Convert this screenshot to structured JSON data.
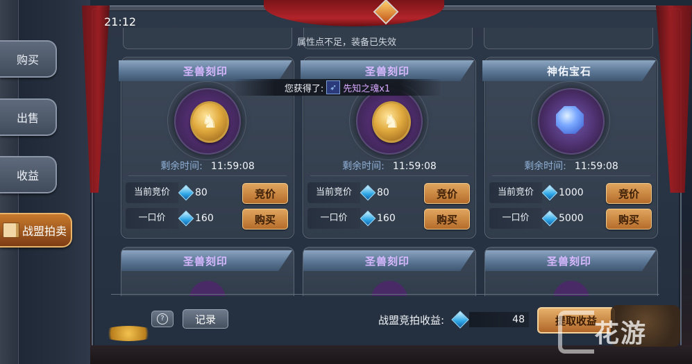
{
  "clock": "21:12",
  "notice": "属性点不足，装备已失效",
  "sidebar": {
    "tabs": [
      {
        "label": "购买",
        "active": false
      },
      {
        "label": "出售",
        "active": false
      },
      {
        "label": "收益",
        "active": false
      },
      {
        "label": "战盟拍卖",
        "active": true
      }
    ]
  },
  "banner": {
    "prefix": "您获得了:",
    "item": "先知之魂x1"
  },
  "labels": {
    "remain": "剩余时间:",
    "current_bid": "当前竞价",
    "buyout": "一口价",
    "bid_btn": "竞价",
    "buy_btn": "购买"
  },
  "cards": [
    {
      "title": "圣兽刻印",
      "item_icon": "golden-horse-medal-icon",
      "remain_time": "11:59:08",
      "current_bid": "80",
      "buyout": "160"
    },
    {
      "title": "圣兽刻印",
      "item_icon": "golden-horse-medal-icon",
      "remain_time": "11:59:08",
      "current_bid": "80",
      "buyout": "160"
    },
    {
      "title": "神佑宝石",
      "item_icon": "blue-gem-icon",
      "remain_time": "11:59:08",
      "current_bid": "1000",
      "buyout": "5000"
    }
  ],
  "next_row_titles": [
    "圣兽刻印",
    "圣兽刻印",
    "圣兽刻印"
  ],
  "footer": {
    "help_icon": "question-icon",
    "record_label": "记录",
    "earnings_label": "战盟竞拍收益:",
    "earnings_value": "48",
    "withdraw_label": "提取收益"
  },
  "watermark": "花游",
  "colors": {
    "accent_orange": "#c87a2c",
    "title_purple": "#d8b8ff",
    "gem_blue": "#2da6e6",
    "curtain_red": "#a11c20"
  }
}
